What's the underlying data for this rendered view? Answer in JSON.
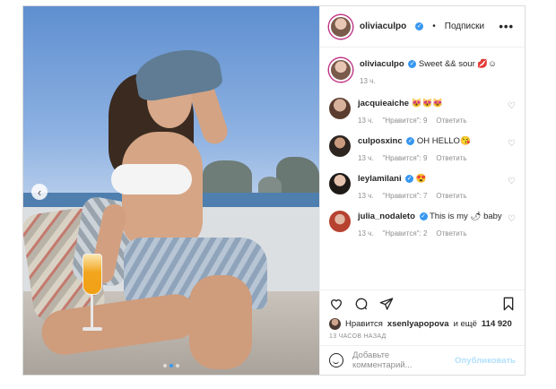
{
  "post": {
    "author": "oliviaculpo",
    "separator": "•",
    "follow_label": "Подписки",
    "more_label": "•••"
  },
  "caption": {
    "user": "oliviaculpo",
    "text": "Sweet && sour 💋☺",
    "time": "13 ч."
  },
  "comments": [
    {
      "user": "jacquieaiche",
      "text": "😻😻😻",
      "time": "13 ч.",
      "likes": "\"Нравится\": 9",
      "reply": "Ответить"
    },
    {
      "user": "culposxinc",
      "text": "OH HELLO😘",
      "time": "13 ч.",
      "likes": "\"Нравится\": 9",
      "reply": "Ответить"
    },
    {
      "user": "leylamilani",
      "text": "😍",
      "time": "13 ч.",
      "likes": "\"Нравится\": 7",
      "reply": "Ответить"
    },
    {
      "user": "julia_nodaleto",
      "text": "This is my 🌶 baby",
      "time": "13 ч.",
      "likes": "\"Нравится\": 2",
      "reply": "Ответить"
    }
  ],
  "likes_line": {
    "prefix": "Нравится",
    "user": "xsenlyapopova",
    "middle": "и ещё",
    "count": "114 920"
  },
  "timestamp": "13 ЧАСОВ НАЗАД",
  "add_comment": {
    "placeholder": "Добавьте комментарий...",
    "publish": "Опубликовать"
  },
  "carousel": {
    "total": 3,
    "active": 2
  },
  "colors": {
    "verified": "#3897f0",
    "publish": "#b2dffc",
    "muted": "#8e8e8e"
  }
}
